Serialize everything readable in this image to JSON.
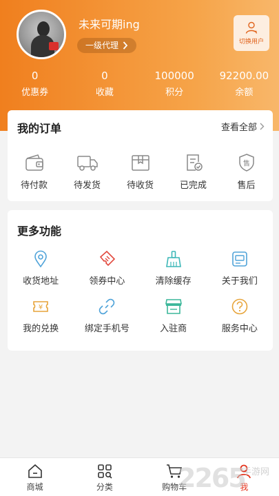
{
  "profile": {
    "nickname": "未来可期ing",
    "level": "一级代理",
    "switch_label": "切换用户"
  },
  "stats": [
    {
      "value": "0",
      "label": "优惠券"
    },
    {
      "value": "0",
      "label": "收藏"
    },
    {
      "value": "100000",
      "label": "积分"
    },
    {
      "value": "92200.00",
      "label": "余额"
    }
  ],
  "orders": {
    "title": "我的订单",
    "view_all": "查看全部",
    "items": [
      {
        "label": "待付款",
        "icon": "wallet-icon"
      },
      {
        "label": "待发货",
        "icon": "truck-icon"
      },
      {
        "label": "待收货",
        "icon": "package-icon"
      },
      {
        "label": "已完成",
        "icon": "document-check-icon"
      },
      {
        "label": "售后",
        "icon": "after-sales-shield-icon"
      }
    ]
  },
  "more": {
    "title": "更多功能",
    "items": [
      {
        "label": "收货地址",
        "icon": "location-pin-icon",
        "color": "#4fa3d9"
      },
      {
        "label": "领券中心",
        "icon": "coupon-ticket-icon",
        "color": "#e2483d"
      },
      {
        "label": "清除缓存",
        "icon": "broom-icon",
        "color": "#3cb7b7"
      },
      {
        "label": "关于我们",
        "icon": "info-card-icon",
        "color": "#4fa3d9"
      },
      {
        "label": "我的兑换",
        "icon": "yuan-ticket-icon",
        "color": "#e7a43a"
      },
      {
        "label": "绑定手机号",
        "icon": "link-chain-icon",
        "color": "#4fa3d9"
      },
      {
        "label": "入驻商",
        "icon": "storefront-icon",
        "color": "#3cb79a"
      },
      {
        "label": "服务中心",
        "icon": "help-circle-icon",
        "color": "#e7a43a"
      }
    ]
  },
  "tabbar": [
    {
      "label": "商城",
      "icon": "home-icon"
    },
    {
      "label": "分类",
      "icon": "category-grid-icon"
    },
    {
      "label": "购物车",
      "icon": "cart-icon"
    },
    {
      "label": "我",
      "icon": "user-icon"
    }
  ],
  "watermark": {
    "big": "2265",
    "small": "手游网"
  },
  "colors": {
    "accent": "#f07f1e",
    "active_tab": "#e5331c"
  }
}
